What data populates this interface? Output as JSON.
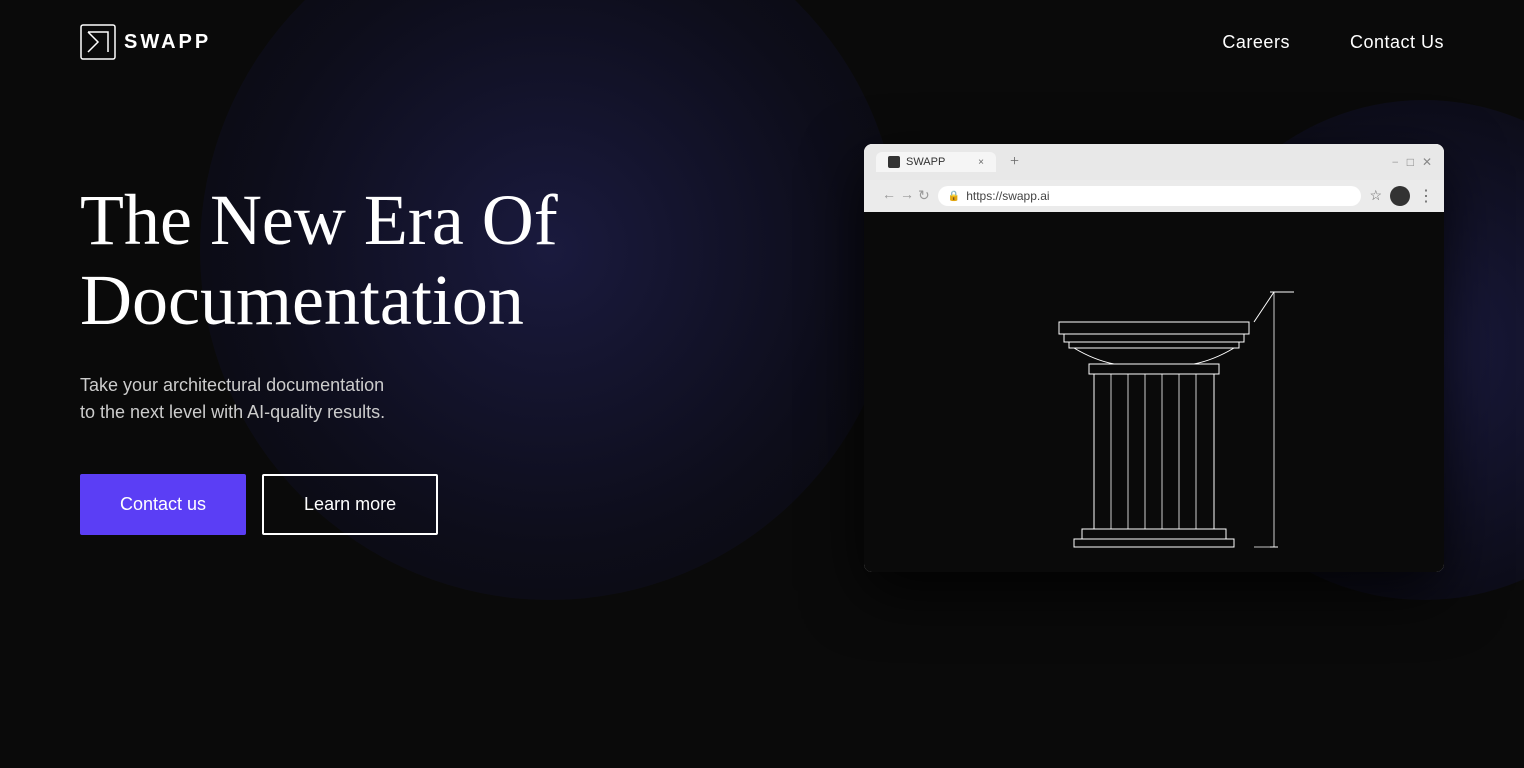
{
  "logo": {
    "text": "SWAPP"
  },
  "nav": {
    "careers_label": "Careers",
    "contact_label": "Contact Us"
  },
  "hero": {
    "title_line1": "The New Era Of",
    "title_line2": "Documentation",
    "subtitle_line1": "Take your architectural documentation",
    "subtitle_line2": "to the next level with AI-quality results.",
    "btn_contact": "Contact us",
    "btn_learn": "Learn more"
  },
  "browser": {
    "tab_label": "SWAPP",
    "url": "https://swapp.ai",
    "tab_close": "×",
    "tab_new": "+"
  },
  "colors": {
    "bg": "#0a0a0a",
    "accent": "#5b3ef5",
    "text": "#ffffff",
    "nav_bg": "#e8e8e8"
  }
}
